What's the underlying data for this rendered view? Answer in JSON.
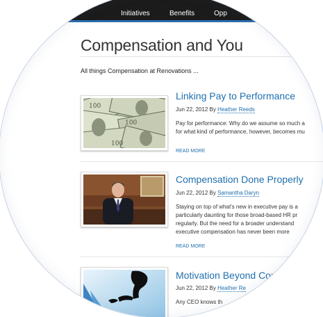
{
  "nav": {
    "items": [
      "Initiatives",
      "Benefits",
      "Opp"
    ]
  },
  "page": {
    "title": "Compensation and You",
    "tagline": "All things Compensation at Renovations ..."
  },
  "posts": [
    {
      "title": "Linking Pay to Performance",
      "date": "Jun 22, 2012",
      "by": "By",
      "author": "Heather Reeds",
      "excerpt_lines": [
        "Pay for performance: Why do we assume so much a",
        "for what kind of performance, however, becomes mu"
      ],
      "read_more": "READ MORE",
      "thumb_icon": "money-image"
    },
    {
      "title": "Compensation Done Properly",
      "date": "Jun 22, 2012",
      "by": "By",
      "author": "Samantha Daryn",
      "excerpt_lines": [
        "Staying on top of what's new in executive pay is a",
        "particularly daunting for those broad-based HR pr",
        "regularly. But the need for a broader understand",
        "executive compensation has never been more"
      ],
      "read_more": "READ MORE",
      "thumb_icon": "executive-portrait-image"
    },
    {
      "title": "Motivation Beyond Com",
      "date": "Jun 22, 2012",
      "by": "By",
      "author": "Heather Re",
      "excerpt_lines": [
        "Any CEO knows th"
      ],
      "read_more": "",
      "thumb_icon": "reaching-hands-image"
    }
  ]
}
